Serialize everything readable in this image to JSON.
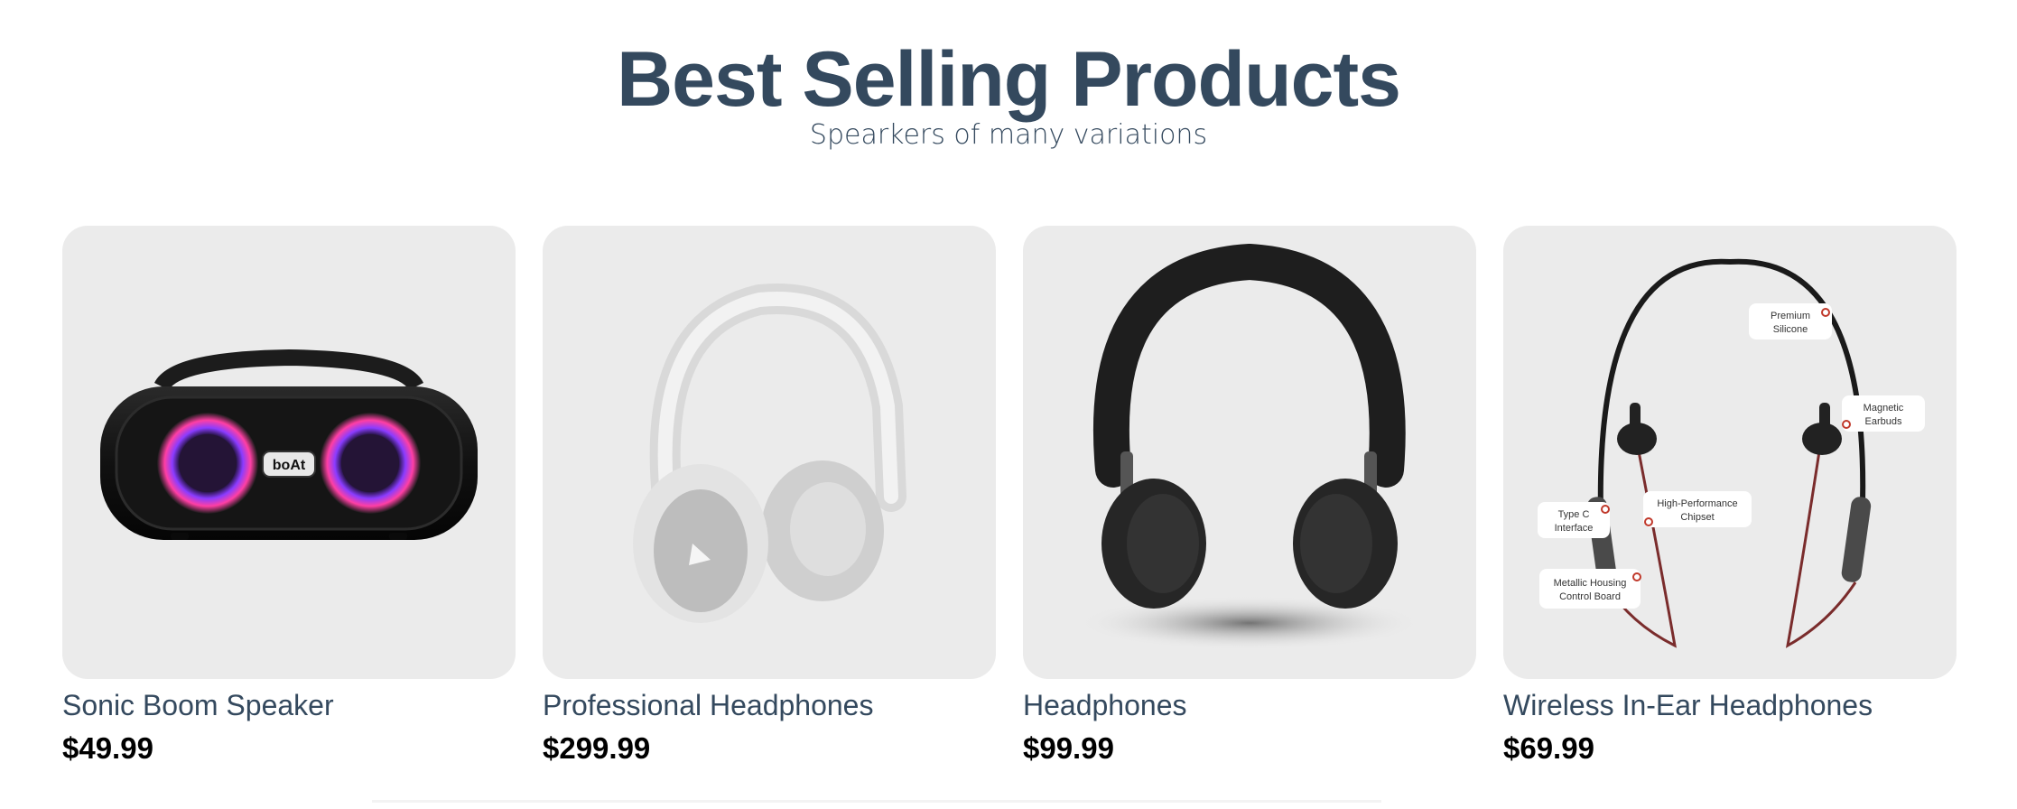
{
  "header": {
    "title": "Best Selling Products",
    "subtitle": "Spearkers of many variations"
  },
  "products": [
    {
      "name": "Sonic Boom Speaker",
      "price": "$49.99",
      "icon": "speaker-image",
      "brand_text": "boAt"
    },
    {
      "name": "Professional Headphones",
      "price": "$299.99",
      "icon": "white-headphones-image"
    },
    {
      "name": "Headphones",
      "price": "$99.99",
      "icon": "black-headphones-image"
    },
    {
      "name": "Wireless In-Ear Headphones",
      "price": "$69.99",
      "icon": "neckband-earphones-image",
      "callouts": {
        "silicone_1": "Premium",
        "silicone_2": "Silicone",
        "magnetic_1": "Magnetic",
        "magnetic_2": "Earbuds",
        "typec_1": "Type C",
        "typec_2": "Interface",
        "chipset_1": "High-Performance",
        "chipset_2": "Chipset",
        "housing_1": "Metallic Housing",
        "housing_2": "Control Board"
      }
    }
  ],
  "colors": {
    "heading": "#34495e",
    "price": "#000000",
    "card_bg": "#ebebeb"
  }
}
